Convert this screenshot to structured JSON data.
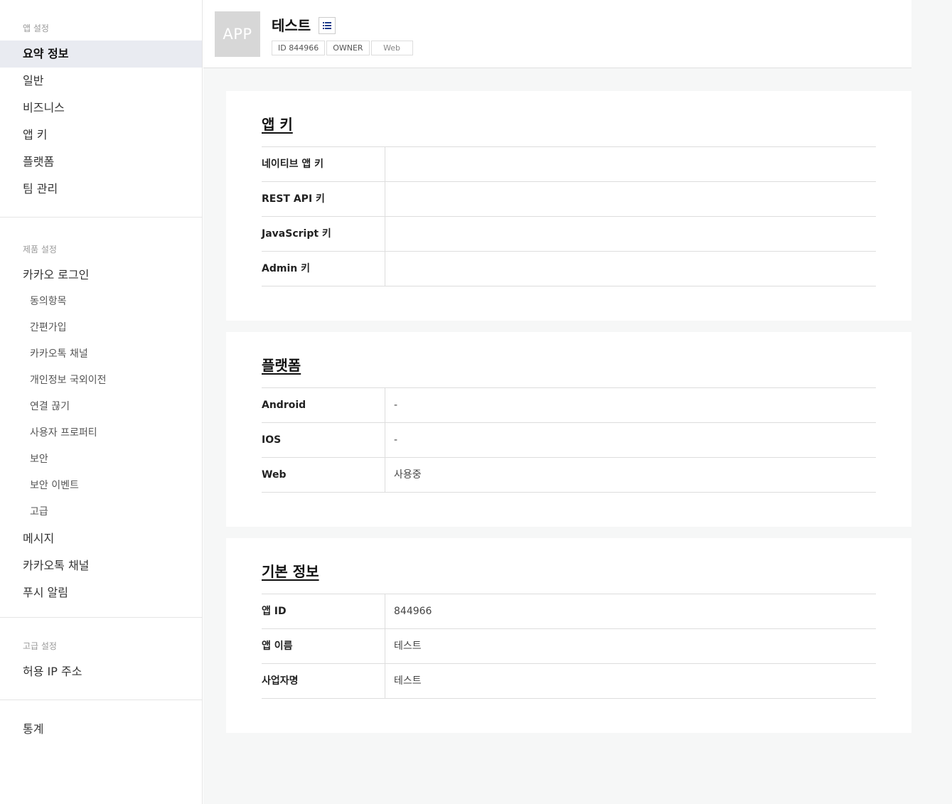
{
  "sidebar": {
    "groups": [
      {
        "title": "앱 설정",
        "items": [
          "요약 정보",
          "일반",
          "비즈니스",
          "앱 키",
          "플랫폼",
          "팀 관리"
        ]
      },
      {
        "title": "제품 설정",
        "kakao_login": "카카오 로그인",
        "sub_items": [
          "동의항목",
          "간편가입",
          "카카오톡 채널",
          "개인정보 국외이전",
          "연결 끊기",
          "사용자 프로퍼티",
          "보안",
          "보안 이벤트",
          "고급"
        ],
        "items": [
          "메시지",
          "카카오톡 채널",
          "푸시 알림"
        ]
      },
      {
        "title": "고급 설정",
        "items": [
          "허용 IP 주소"
        ]
      },
      {
        "items": [
          "통계"
        ]
      }
    ]
  },
  "header": {
    "icon_text": "APP",
    "app_name": "테스트",
    "list_icon": "list-icon",
    "tags": [
      "ID 844966",
      "OWNER",
      "Web"
    ]
  },
  "app_keys": {
    "title": "앱 키",
    "rows": [
      {
        "label": "네이티브 앱 키",
        "value": ""
      },
      {
        "label": "REST API 키",
        "value": ""
      },
      {
        "label": "JavaScript 키",
        "value": ""
      },
      {
        "label": "Admin 키",
        "value": ""
      }
    ]
  },
  "platform": {
    "title": "플랫폼",
    "rows": [
      {
        "label": "Android",
        "value": "-"
      },
      {
        "label": "IOS",
        "value": "-"
      },
      {
        "label": "Web",
        "value": "사용중"
      }
    ]
  },
  "basic_info": {
    "title": "기본 정보",
    "rows": [
      {
        "label": "앱 ID",
        "value": "844966"
      },
      {
        "label": "앱 이름",
        "value": "테스트"
      },
      {
        "label": "사업자명",
        "value": "테스트"
      }
    ]
  },
  "colors": {
    "active_bg": "#e9ebf1",
    "content_bg": "#f6f7f7",
    "icon_bg": "#d7d7d7"
  }
}
